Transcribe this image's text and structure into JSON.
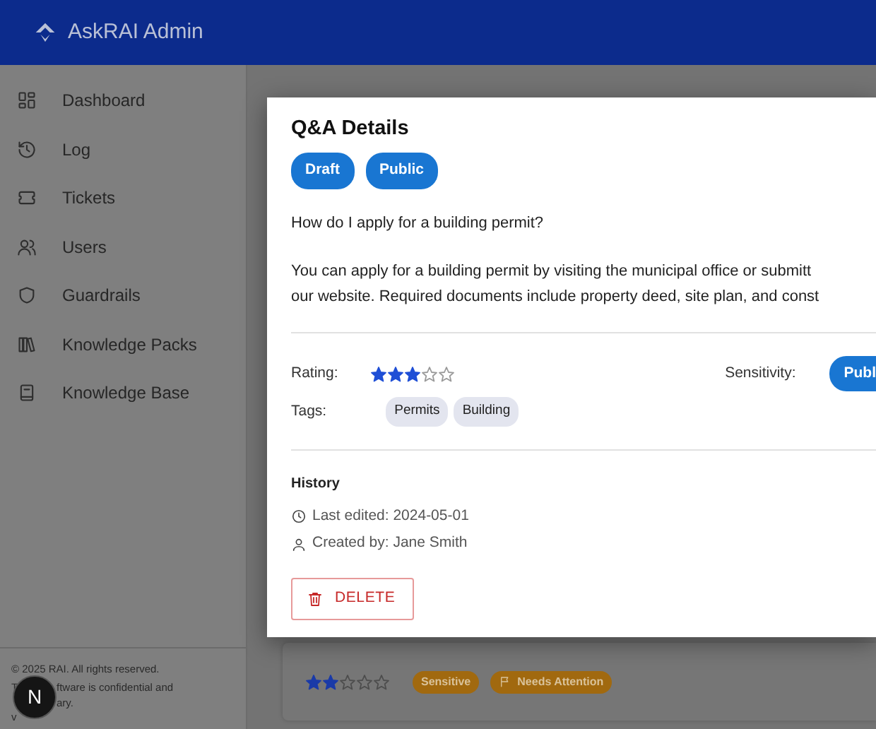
{
  "header": {
    "title": "AskRAI Admin"
  },
  "sidebar": {
    "items": [
      {
        "label": "Dashboard"
      },
      {
        "label": "Log"
      },
      {
        "label": "Tickets"
      },
      {
        "label": "Users"
      },
      {
        "label": "Guardrails"
      },
      {
        "label": "Knowledge Packs"
      },
      {
        "label": "Knowledge Base"
      }
    ],
    "footer": {
      "copyright": "© 2025 RAI. All rights reserved.",
      "line_2_start": "T",
      "line_2_end": "ftware is confidential and",
      "line_3_end": "ary.",
      "line_4_start": "v"
    }
  },
  "background_card": {
    "stars": 2,
    "tags": [
      {
        "label": "Sensitive",
        "kind": "plain"
      },
      {
        "label": "Needs Attention",
        "kind": "flag"
      }
    ]
  },
  "modal": {
    "title": "Q&A Details",
    "badges": [
      "Draft",
      "Public"
    ],
    "question": "How do I apply for a building permit?",
    "answer": [
      "You can apply for a building permit by visiting the municipal office or submitt",
      "our website. Required documents include property deed, site plan, and const"
    ],
    "rating": {
      "label": "Rating:",
      "stars": 3
    },
    "sensitivity": {
      "label": "Sensitivity:",
      "value": "Publ"
    },
    "tags": {
      "label": "Tags:",
      "items": [
        "Permits",
        "Building"
      ]
    },
    "history": {
      "title": "History",
      "last_edited": "Last edited: 2024-05-01",
      "created_by": "Created by: Jane Smith"
    },
    "delete_button": "DELETE"
  },
  "dev_badge": "N"
}
